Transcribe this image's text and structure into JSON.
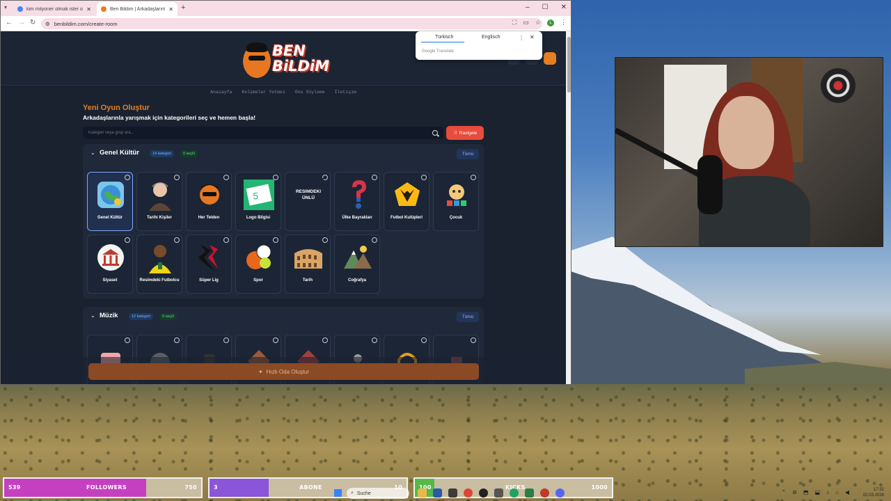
{
  "browser": {
    "tabs": [
      {
        "title": "kim milyoner olmak ister oyunu",
        "active": false
      },
      {
        "title": "Ben Bildim | Arkadaşlarınla Onli",
        "active": true
      }
    ],
    "url": "benbildim.com/create-room"
  },
  "translate_popup": {
    "lang_source": "Türkisch",
    "lang_target": "Englisch",
    "footer": "Google Translate"
  },
  "site": {
    "logo_text_1": "BEN",
    "logo_text_2": "BiLDiM",
    "nav": [
      "Anasayfa",
      "Kelimeler Yetmez",
      "Onu Söyleme",
      "İletişim"
    ],
    "title": "Yeni Oyun Oluştur",
    "subtitle": "Arkadaşlarınla yarışmak için kategorileri seç ve hemen başla!",
    "search_placeholder": "Kategori veya grup ara...",
    "random_label": "Rastgele",
    "create_label": "Hızlı Oda Oluştur"
  },
  "sections": [
    {
      "title": "Genel Kültür",
      "count_label": "14 kategori",
      "selected_label": "0 seçili",
      "all_label": "Tümü",
      "categories": [
        {
          "label": "Genel Kültür",
          "icon": "globe-icon",
          "selected": true
        },
        {
          "label": "Tarihi Kişiler",
          "icon": "portrait-icon",
          "selected": false
        },
        {
          "label": "Her Telden",
          "icon": "mascot-icon",
          "selected": false
        },
        {
          "label": "Logo Bilgisi",
          "icon": "logo-icon",
          "selected": false
        },
        {
          "label": "",
          "icon": "celebrity-icon",
          "image_text": "RESIMDEKI ÜNLÜ",
          "selected": false
        },
        {
          "label": "Ülke Bayrakları",
          "icon": "flag-question-icon",
          "selected": false
        },
        {
          "label": "Futbol Kulüpleri",
          "icon": "wolf-crest-icon",
          "selected": false
        },
        {
          "label": "Çocuk",
          "icon": "toy-icon",
          "selected": false
        },
        {
          "label": "Siyaset",
          "icon": "government-icon",
          "selected": false
        },
        {
          "label": "Resimdeki Futbolcu",
          "icon": "footballer-icon",
          "selected": false
        },
        {
          "label": "Süper Lig",
          "icon": "league-icon",
          "selected": false
        },
        {
          "label": "Spor",
          "icon": "sports-balls-icon",
          "selected": false
        },
        {
          "label": "Tarih",
          "icon": "colosseum-icon",
          "selected": false
        },
        {
          "label": "Coğrafya",
          "icon": "landscape-icon",
          "selected": false
        }
      ]
    },
    {
      "title": "Müzik",
      "count_label": "12 kategori",
      "selected_label": "0 seçili",
      "all_label": "Tümü"
    }
  ],
  "overlay": {
    "followers": {
      "current": "539",
      "label": "FOLLOWERS",
      "goal": "750",
      "progress": 0.72,
      "color": "#c540c0"
    },
    "abone": {
      "current": "3",
      "label": "ABONE",
      "goal": "10",
      "progress": 0.3,
      "color": "#8a55d8"
    },
    "kicks": {
      "current": "100",
      "label": "KICKS",
      "goal": "1000",
      "progress": 0.1,
      "color": "#57b84a"
    }
  },
  "taskbar": {
    "search_label": "Suche",
    "time": "17:32",
    "date": "02.03.2026"
  }
}
